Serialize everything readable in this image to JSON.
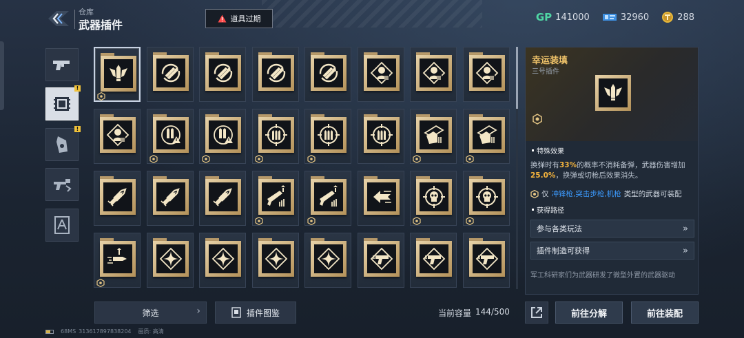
{
  "header": {
    "subtitle": "仓库",
    "title": "武器插件",
    "expire_label": "道具过期"
  },
  "currencies": [
    {
      "icon": "gp-currency-icon",
      "label": "GP",
      "value": "141000",
      "color": "#4fd6a4"
    },
    {
      "icon": "ticket-currency-icon",
      "value": "32960",
      "color": "#5fb4ff"
    },
    {
      "icon": "coin-currency-icon",
      "value": "288",
      "color": "#f2c94c"
    }
  ],
  "side_tabs": [
    {
      "name": "tab-weapons",
      "icon": "pistol-icon",
      "active": false,
      "badge": false
    },
    {
      "name": "tab-plugins",
      "icon": "plugin-chip-icon",
      "active": true,
      "badge": true
    },
    {
      "name": "tab-skins",
      "icon": "skin-tag-icon",
      "active": false,
      "badge": true
    },
    {
      "name": "tab-accessories",
      "icon": "gun-accessory-icon",
      "active": false,
      "badge": false
    },
    {
      "name": "tab-blueprints",
      "icon": "blueprint-icon",
      "active": false,
      "badge": false
    }
  ],
  "grid": {
    "rows": [
      [
        "bullet-wing-icon",
        "reload-cycle-icon",
        "reload-cycle-icon",
        "reload-cycle-icon",
        "reload-cycle-icon",
        "target-head-icon",
        "target-head-icon",
        "target-head-icon"
      ],
      [
        "target-head-icon",
        "ammo-warning-icon",
        "ammo-warning-icon",
        "crosshair-ammo-icon",
        "crosshair-ammo-icon",
        "crosshair-ammo-icon",
        "hand-card-icon",
        "hand-card-icon"
      ],
      [
        "rocket-bullets-icon",
        "rocket-bullets-icon",
        "rocket-bullets-icon",
        "rifle-upgrade-icon",
        "rifle-upgrade-icon",
        "speed-arrow-icon",
        "skull-target-icon",
        "skull-target-icon"
      ],
      [
        "bullet-flight-icon",
        "diamond-star-icon",
        "diamond-star-icon",
        "diamond-star-icon",
        "diamond-star-icon",
        "pistol-speed-icon",
        "pistol-speed-icon",
        "pistol-speed-icon"
      ]
    ],
    "marked": [
      [
        0,
        0
      ],
      [
        1,
        1
      ],
      [
        1,
        2
      ],
      [
        1,
        3
      ],
      [
        1,
        4
      ],
      [
        1,
        6
      ],
      [
        1,
        7
      ],
      [
        2,
        3
      ],
      [
        2,
        4
      ],
      [
        2,
        6
      ],
      [
        2,
        7
      ],
      [
        3,
        0
      ]
    ],
    "selected": [
      0,
      0
    ]
  },
  "detail": {
    "name": "幸运装填",
    "type": "三号插件",
    "effect_header": "特殊效果",
    "effect": {
      "p1": "换弹时有",
      "pct": "33%",
      "p2": "的概率不消耗备弹，武器伤害增加",
      "dmg": "25.0%",
      "p3": "，换弹或切枪后效果消失。"
    },
    "restrict": {
      "prefix": "仅",
      "weapons": "冲锋枪,突击步枪,机枪",
      "suffix": "类型的武器可装配"
    },
    "source_header": "获得路径",
    "sources": [
      "参与各类玩法",
      "插件制造可获得"
    ],
    "description": "军工科研家们为武器研发了微型外置的武器驱动"
  },
  "bottom": {
    "filter_label": "筛选",
    "guide_label": "插件图鉴",
    "capacity_label": "当前容量",
    "capacity_value": "144/500",
    "decompose_label": "前往分解",
    "equip_label": "前往装配"
  },
  "status": {
    "ping": "68MS",
    "id": "313617897838204",
    "quality": "画质: 高清"
  }
}
